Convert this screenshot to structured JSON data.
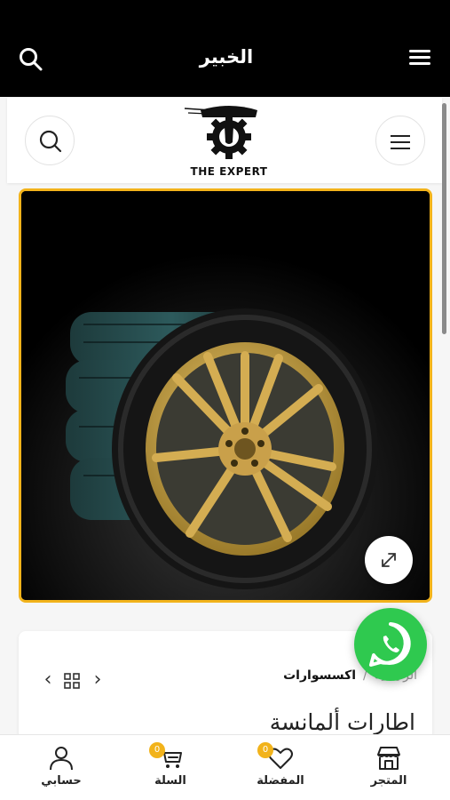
{
  "topbar": {
    "title": "الخبير"
  },
  "header": {
    "logo_text": "THE EXPERT"
  },
  "breadcrumb": {
    "home": "الرئيسية",
    "separator": "/",
    "current": "اكسسوارات"
  },
  "product": {
    "title": "اطارات ألمانسة"
  },
  "bottom_nav": {
    "items": [
      {
        "label": "المتجر",
        "icon": "store-icon"
      },
      {
        "label": "المفضلة",
        "icon": "heart-icon",
        "badge": "0"
      },
      {
        "label": "السلة",
        "icon": "cart-icon",
        "badge": "0"
      },
      {
        "label": "حسابي",
        "icon": "user-icon"
      }
    ]
  },
  "colors": {
    "accent": "#f2b31b",
    "whatsapp": "#2fc94f",
    "topbar": "#000000"
  }
}
